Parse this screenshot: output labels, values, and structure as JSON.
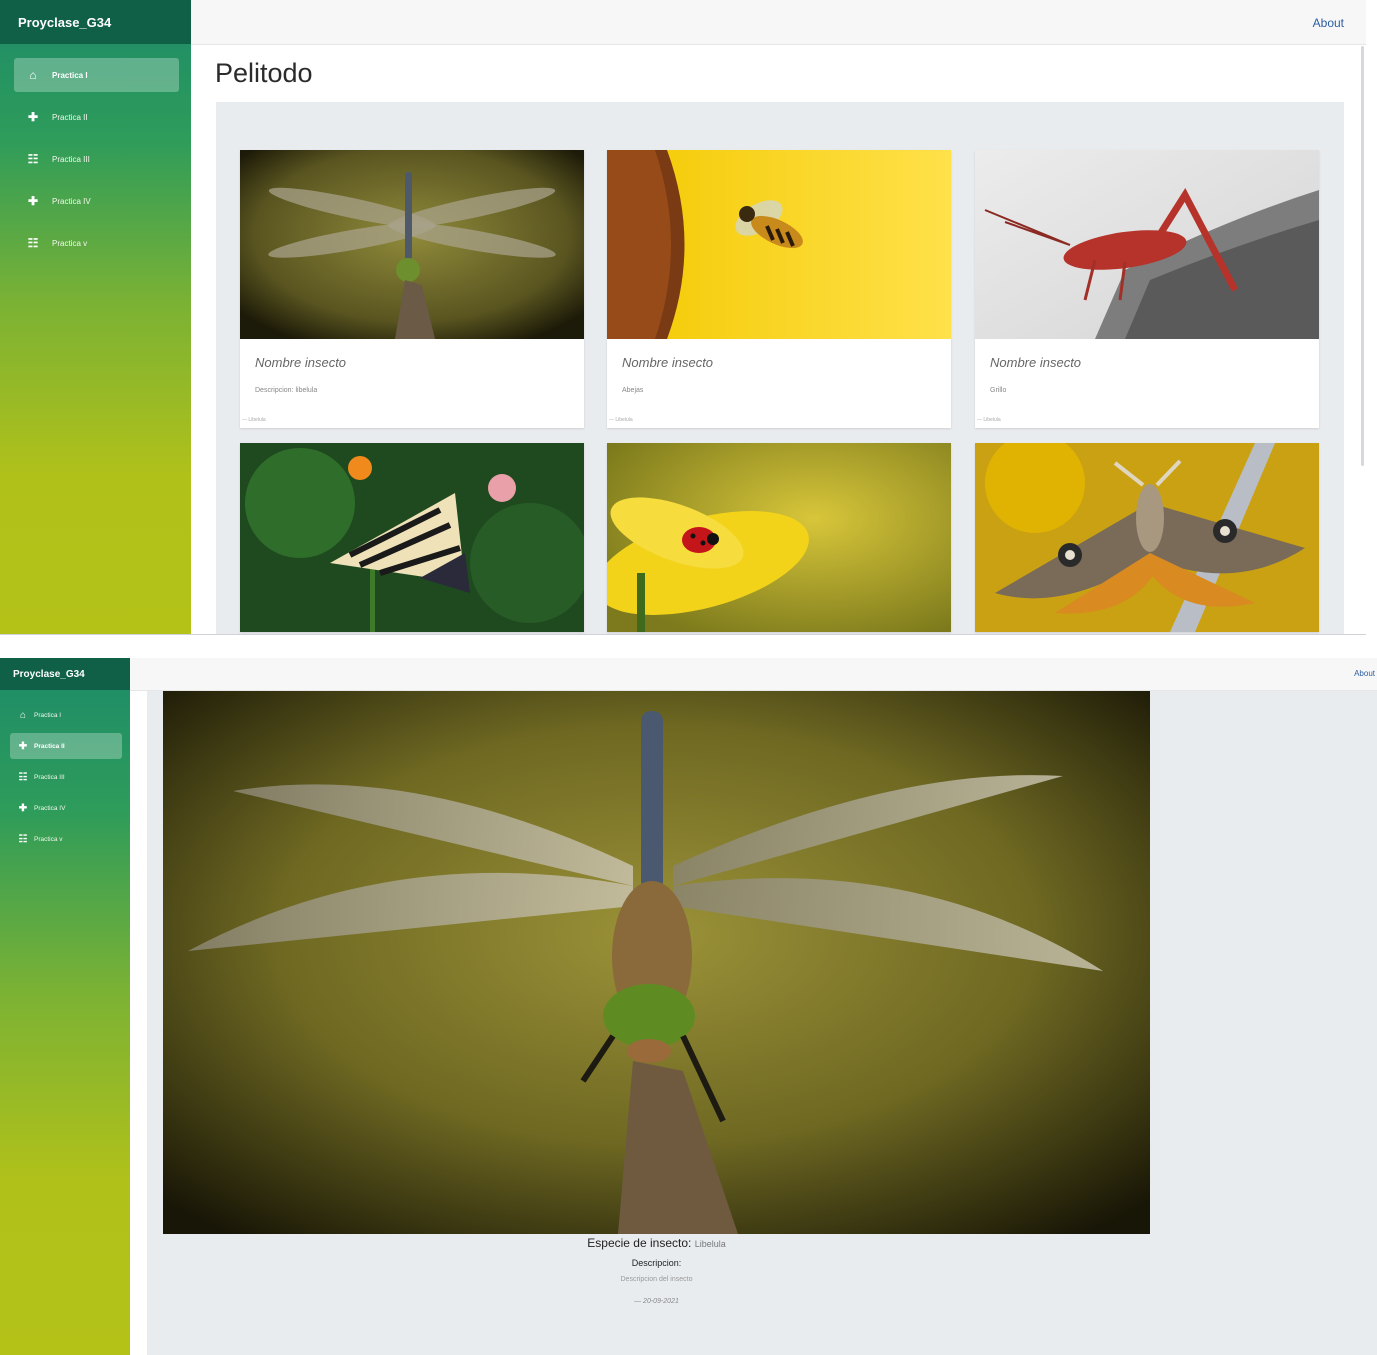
{
  "app": {
    "brand": "Proyclase_G34",
    "about": "About"
  },
  "sidebar": {
    "items": [
      {
        "label": "Practica I",
        "icon": "home-icon",
        "glyph": "⌂"
      },
      {
        "label": "Practica II",
        "icon": "plus-icon",
        "glyph": "✚"
      },
      {
        "label": "Practica III",
        "icon": "list-icon",
        "glyph": "☷"
      },
      {
        "label": "Practica IV",
        "icon": "plus-icon",
        "glyph": "✚"
      },
      {
        "label": "Practica v",
        "icon": "list-icon",
        "glyph": "☷"
      }
    ]
  },
  "view1": {
    "title": "Pelitodo",
    "active_item": "Practica I",
    "cards": [
      {
        "photo": "dragonfly-photo",
        "name": "Nombre insecto",
        "desc": "Descripcion: libelula",
        "foot": "— Libelula"
      },
      {
        "photo": "bee-photo",
        "name": "Nombre insecto",
        "desc": "Abejas",
        "foot": "— Libelula"
      },
      {
        "photo": "grasshopper-photo",
        "name": "Nombre insecto",
        "desc": "Grillo",
        "foot": "— Libelula"
      },
      {
        "photo": "butterfly-photo"
      },
      {
        "photo": "ladybug-photo"
      },
      {
        "photo": "moth-photo"
      }
    ]
  },
  "view2": {
    "active_item": "Practica II",
    "photo": "dragonfly-photo",
    "species_label": "Especie de insecto:",
    "species_value": "Libelula",
    "desc_label": "Descripcion:",
    "desc_value": "Descripcion del insecto",
    "date": "— 20-09-2021"
  },
  "colors": {
    "brand_bg": "#0f6047",
    "sidebar_top": "#1d8b69",
    "sidebar_bottom": "#b4c218",
    "link": "#2c5d9e",
    "panel_bg": "#e9ecef"
  }
}
